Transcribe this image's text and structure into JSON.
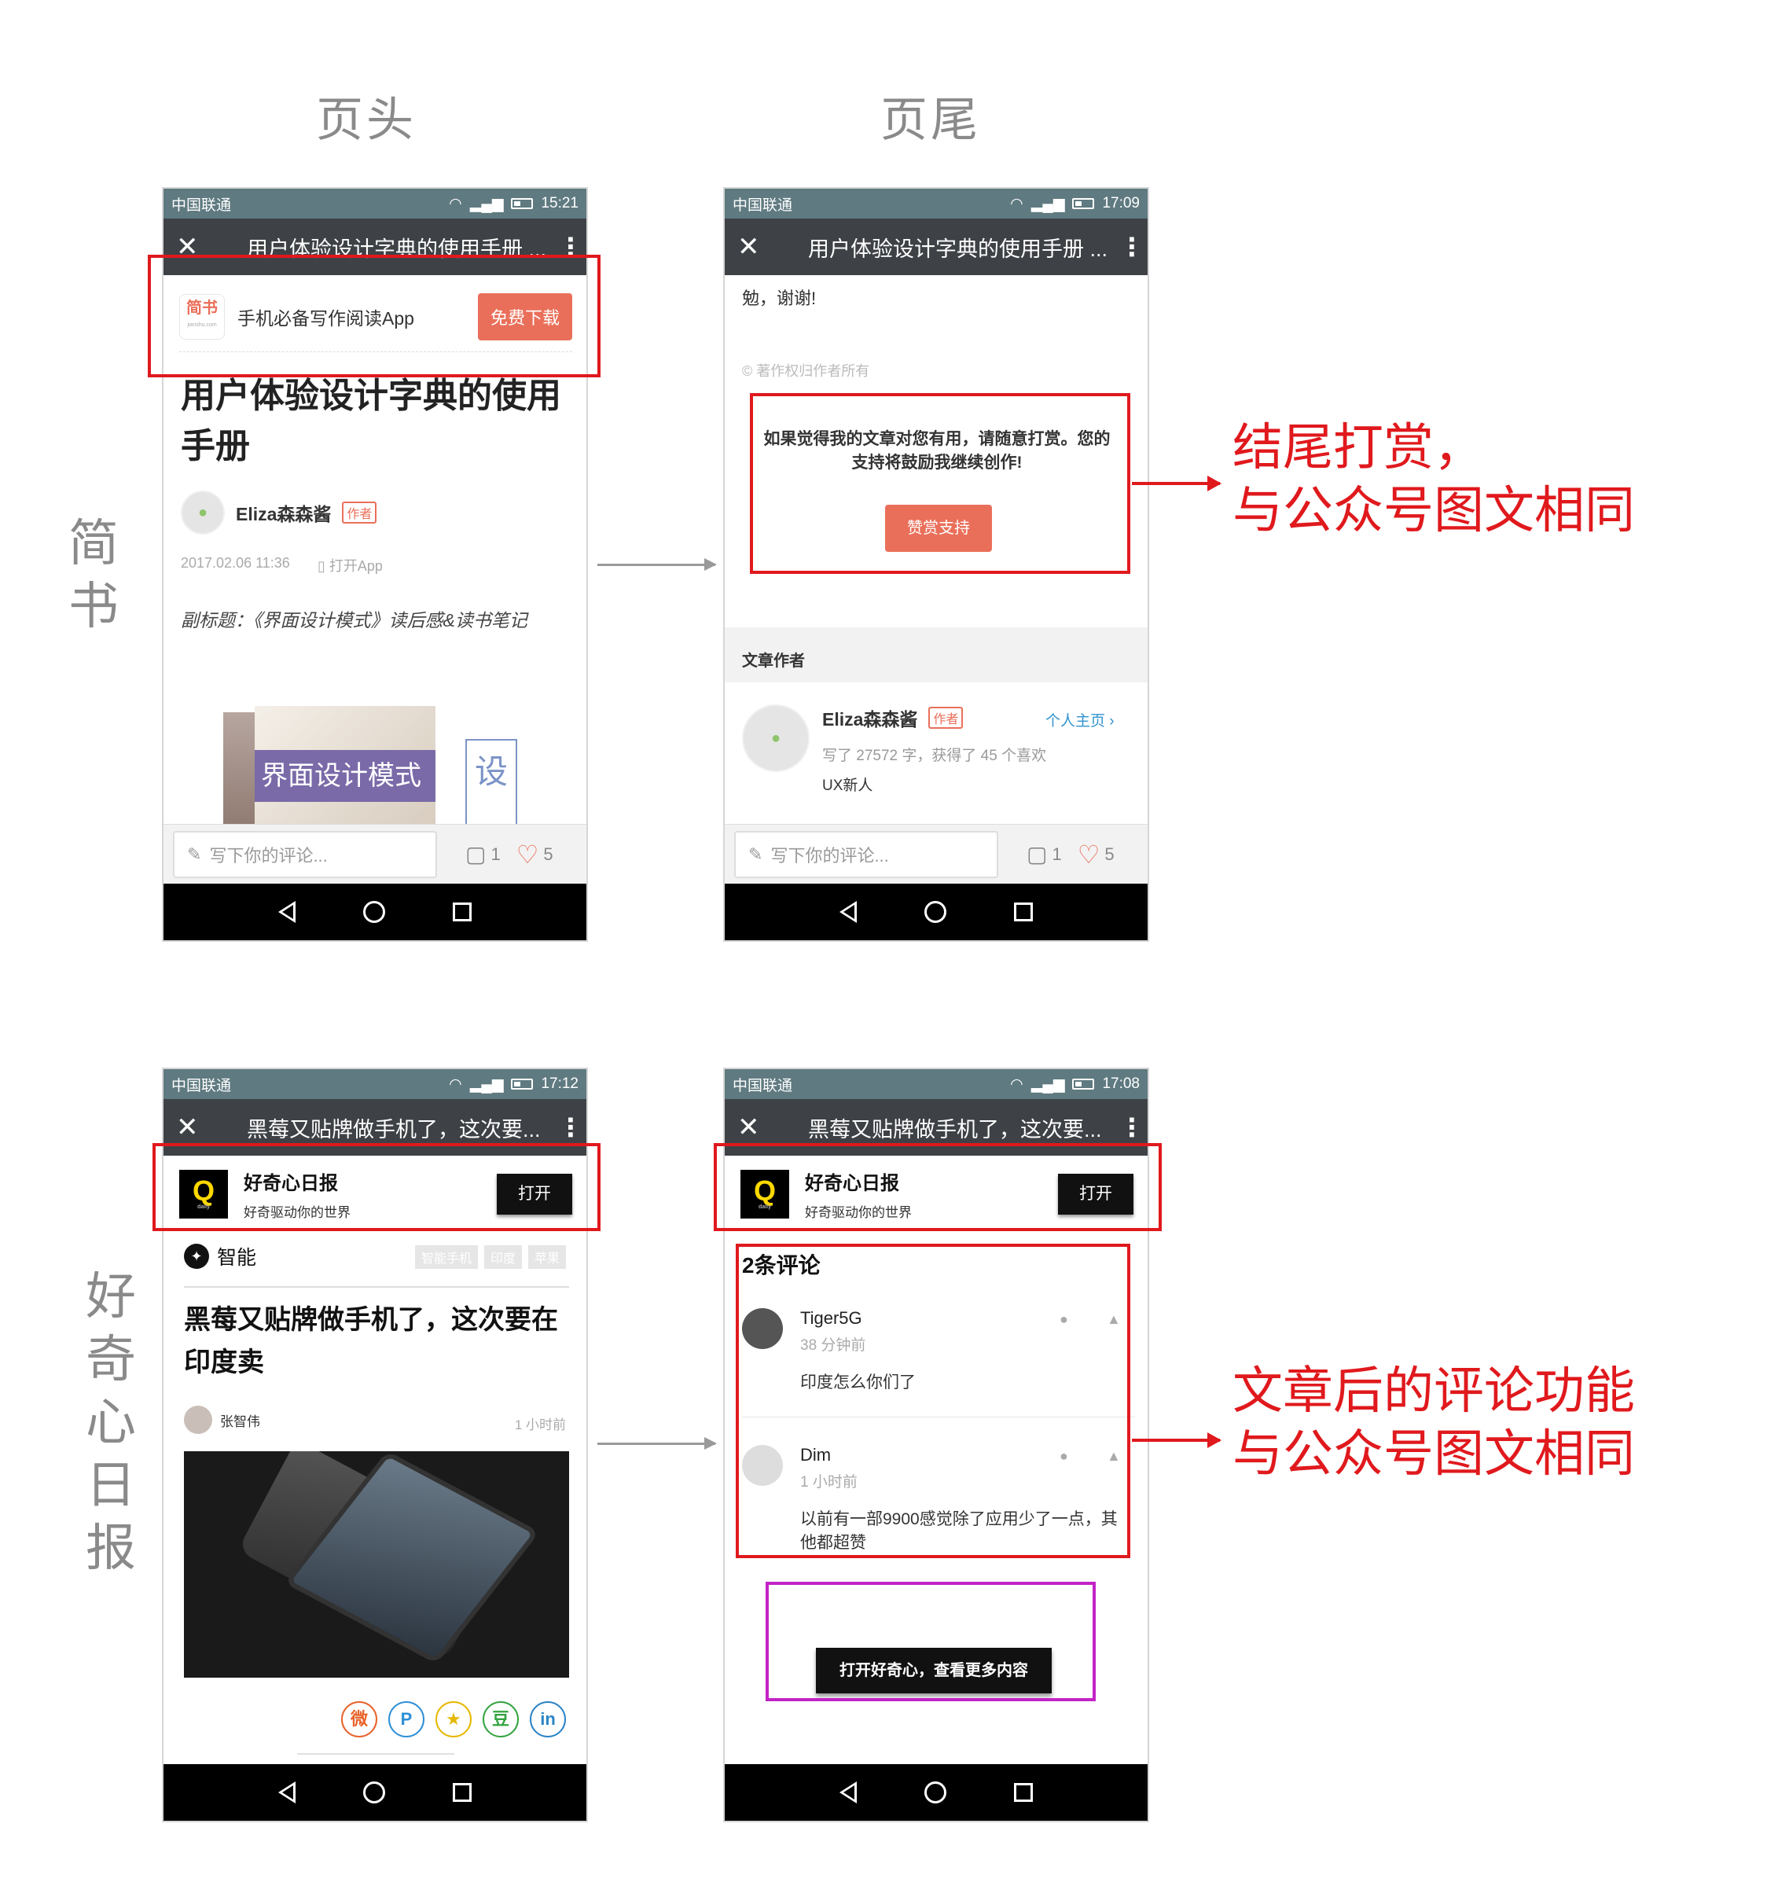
{
  "headers": {
    "left": "页头",
    "right": "页尾"
  },
  "side_labels": {
    "jianshu": [
      "简",
      "书"
    ],
    "haoqixin": [
      "好",
      "奇",
      "心",
      "日",
      "报"
    ]
  },
  "notes": {
    "jianshu": [
      "结尾打赏，",
      "与公众号图文相同"
    ],
    "haoqixin": [
      "文章后的评论功能",
      "与公众号图文相同"
    ]
  },
  "nav_glyphs": {
    "back": "◁",
    "home": "○",
    "recent": "□"
  },
  "jianshu_head": {
    "status": {
      "carrier": "中国联通",
      "time": "15:21"
    },
    "title": "用户体验设计字典的使用手册 ...",
    "banner": {
      "logo": "简书",
      "logo_sub": "jianshu.com",
      "text": "手机必备写作阅读App",
      "button": "免费下载"
    },
    "article_title": "用户体验设计字典的使用手册",
    "author": "Eliza森森酱",
    "author_tag": "作者",
    "date": "2017.02.06 11:36",
    "open_app": "打开App",
    "subtitle": "副标题：《界面设计模式》读后感&读书笔记",
    "book_title": "界面设计模式",
    "book2_char": "设",
    "comment_placeholder": "写下你的评论...",
    "comment_count": "1",
    "like_count": "5"
  },
  "jianshu_tail": {
    "status": {
      "carrier": "中国联通",
      "time": "17:09"
    },
    "title": "用户体验设计字典的使用手册 ...",
    "end_text": "勉，谢谢!",
    "copyright": "© 著作权归作者所有",
    "reward_text": "如果觉得我的文章对您有用，请随意打赏。您的支持将鼓励我继续创作!",
    "reward_button": "赞赏支持",
    "section": "文章作者",
    "author": "Eliza森森酱",
    "author_tag": "作者",
    "profile_link": "个人主页 ›",
    "stats": "写了 27572 字，获得了 45 个喜欢",
    "bio": "UX新人",
    "comment_placeholder": "写下你的评论...",
    "comment_count": "1",
    "like_count": "5"
  },
  "haoqixin_head": {
    "status": {
      "carrier": "中国联通",
      "time": "17:12"
    },
    "title": "黑莓又贴牌做手机了，这次要...",
    "banner": {
      "logo": "Q",
      "logo_sub": "daily",
      "name": "好奇心日报",
      "slogan": "好奇驱动你的世界",
      "button": "打开"
    },
    "category": "智能",
    "tags": [
      "智能手机",
      "印度",
      "苹果"
    ],
    "article_title": "黑莓又贴牌做手机了，这次要在印度卖",
    "author": "张智伟",
    "time": "1 小时前",
    "share_icons": [
      "微",
      "P",
      "★",
      "豆",
      "in"
    ]
  },
  "haoqixin_tail": {
    "status": {
      "carrier": "中国联通",
      "time": "17:08"
    },
    "title": "黑莓又贴牌做手机了，这次要...",
    "banner": {
      "logo": "Q",
      "logo_sub": "daily",
      "name": "好奇心日报",
      "slogan": "好奇驱动你的世界",
      "button": "打开"
    },
    "comments_heading": "2条评论",
    "comments": [
      {
        "name": "Tiger5G",
        "time": "38 分钟前",
        "text": "印度怎么你们了"
      },
      {
        "name": "Dim",
        "time": "1 小时前",
        "text": "以前有一部9900感觉除了应用少了一点，其他都超赞"
      }
    ],
    "more_button": "打开好奇心，查看更多内容"
  },
  "colors": {
    "annotation_red": "#e0191d",
    "annotation_purple": "#c223c6",
    "jianshu_orange": "#ea6f5a"
  }
}
